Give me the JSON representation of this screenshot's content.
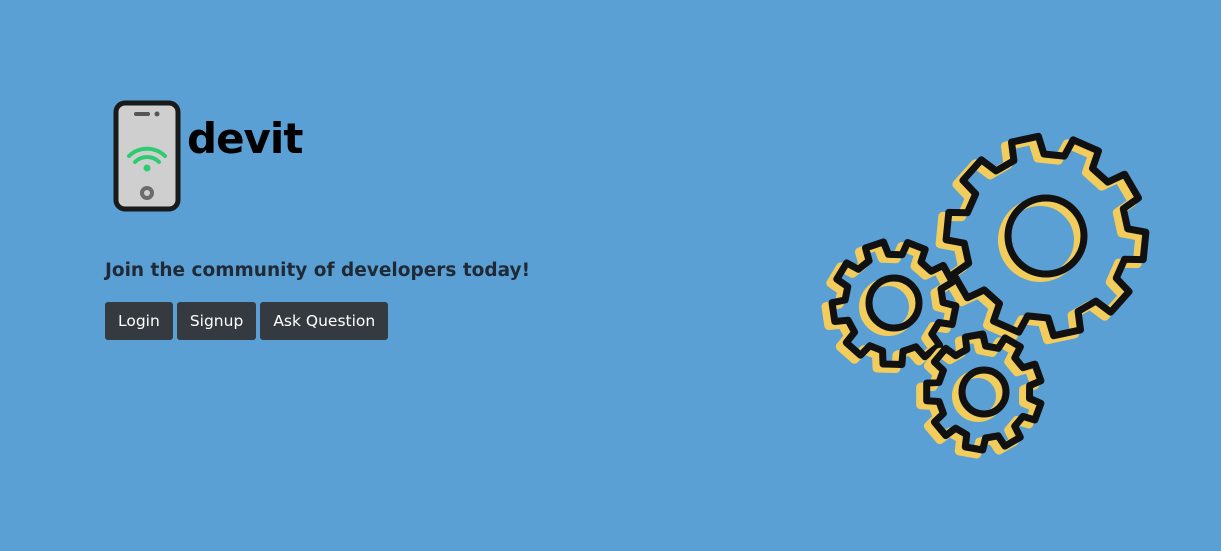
{
  "brand": {
    "name": "devit",
    "logo_icon": "phone-wifi-icon"
  },
  "hero": {
    "tagline": "Join the community of developers today!",
    "illustration_icon": "gears-icon"
  },
  "actions": {
    "login_label": "Login",
    "signup_label": "Signup",
    "ask_label": "Ask Question"
  },
  "colors": {
    "background": "#5ba0d4",
    "button": "#343a40",
    "gear_accent": "#f2cd5c",
    "wifi": "#2ecc71"
  }
}
